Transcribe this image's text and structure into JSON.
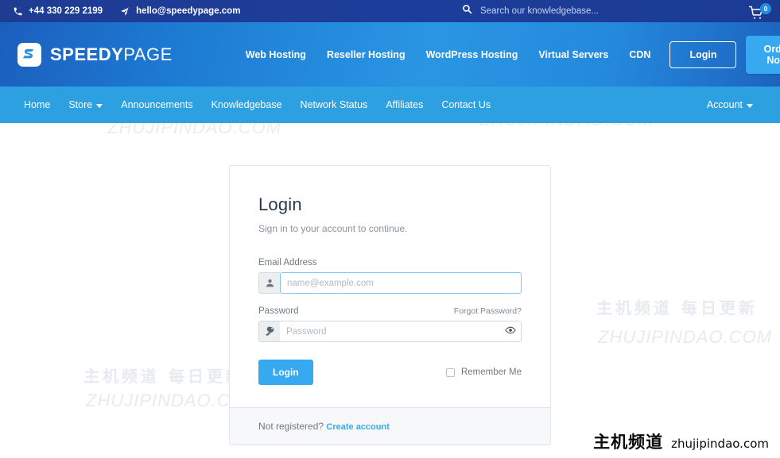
{
  "topbar": {
    "phone": "+44 330 229 2199",
    "email": "hello@speedypage.com",
    "search_placeholder": "Search our knowledgebase...",
    "cart_count": "0"
  },
  "header": {
    "logo_bold": "SPEEDY",
    "logo_light": "PAGE",
    "nav": [
      {
        "label": "Web Hosting"
      },
      {
        "label": "Reseller Hosting"
      },
      {
        "label": "WordPress Hosting"
      },
      {
        "label": "Virtual Servers"
      },
      {
        "label": "CDN"
      }
    ],
    "login_button": "Login",
    "order_button": "Order Now"
  },
  "subnav": {
    "items": [
      {
        "label": "Home",
        "caret": false
      },
      {
        "label": "Store",
        "caret": true
      },
      {
        "label": "Announcements",
        "caret": false
      },
      {
        "label": "Knowledgebase",
        "caret": false
      },
      {
        "label": "Network Status",
        "caret": false
      },
      {
        "label": "Affiliates",
        "caret": false
      },
      {
        "label": "Contact Us",
        "caret": false
      }
    ],
    "account": "Account"
  },
  "login_card": {
    "title": "Login",
    "subtitle": "Sign in to your account to continue.",
    "email_label": "Email Address",
    "email_placeholder": "name@example.com",
    "email_value": "",
    "password_label": "Password",
    "password_placeholder": "Password",
    "password_value": "",
    "forgot_link": "Forgot Password?",
    "submit_button": "Login",
    "remember_label": "Remember Me",
    "footer_text": "Not registered?",
    "footer_link": "Create account"
  },
  "watermarks": {
    "cn_full": "主机频道 每日更新",
    "cn_short": "主机频道",
    "cn_tail": "更新",
    "en": "ZHUJIPINDAO.COM",
    "brand_cn": "主机频道",
    "brand_en": "zhujipindao.com"
  },
  "colors": {
    "topbar": "#1f3c93",
    "header_start": "#1b5fbe",
    "header_mid": "#2a96e3",
    "subnav": "#2ca0e0",
    "accent": "#36a9f0",
    "card_border": "#e3e6ea",
    "title": "#2b3a4a"
  }
}
